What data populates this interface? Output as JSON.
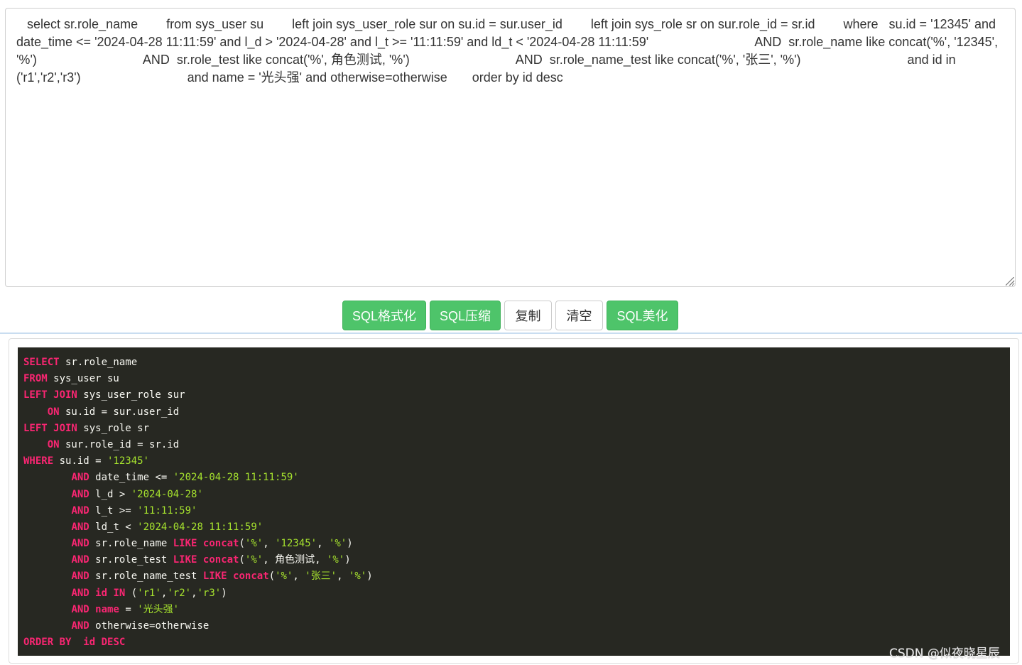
{
  "editor": {
    "raw_sql": "   select sr.role_name        from sys_user su        left join sys_user_role sur on su.id = sur.user_id        left join sys_role sr on sur.role_id = sr.id        where   su.id = '12345' and date_time <= '2024-04-28 11:11:59' and l_d > '2024-04-28' and l_t >= '11:11:59' and ld_t < '2024-04-28 11:11:59'                              AND  sr.role_name like concat('%', '12345', '%')                              AND  sr.role_test like concat('%', 角色测试, '%')                              AND  sr.role_name_test like concat('%', '张三', '%')                              and id in                          ('r1','r2','r3')                              and name = '光头强' and otherwise=otherwise       order by id desc"
  },
  "toolbar": {
    "format_label": "SQL格式化",
    "compress_label": "SQL压缩",
    "copy_label": "复制",
    "clear_label": "清空",
    "beautify_label": "SQL美化"
  },
  "output": {
    "lines": [
      [
        {
          "t": "SELECT",
          "c": "kw"
        },
        {
          "t": " sr.role_name"
        }
      ],
      [
        {
          "t": "FROM",
          "c": "kw"
        },
        {
          "t": " sys_user su"
        }
      ],
      [
        {
          "t": "LEFT JOIN",
          "c": "kw"
        },
        {
          "t": " sys_user_role sur"
        }
      ],
      [
        {
          "t": "    "
        },
        {
          "t": "ON",
          "c": "kw"
        },
        {
          "t": " su.id = sur.user_id"
        }
      ],
      [
        {
          "t": "LEFT JOIN",
          "c": "kw"
        },
        {
          "t": " sys_role sr"
        }
      ],
      [
        {
          "t": "    "
        },
        {
          "t": "ON",
          "c": "kw"
        },
        {
          "t": " sur.role_id = sr.id"
        }
      ],
      [
        {
          "t": "WHERE",
          "c": "kw"
        },
        {
          "t": " su.id = "
        },
        {
          "t": "'12345'",
          "c": "str"
        }
      ],
      [
        {
          "t": "        "
        },
        {
          "t": "AND",
          "c": "kw"
        },
        {
          "t": " date_time <= "
        },
        {
          "t": "'2024-04-28 11:11:59'",
          "c": "str"
        }
      ],
      [
        {
          "t": "        "
        },
        {
          "t": "AND",
          "c": "kw"
        },
        {
          "t": " l_d > "
        },
        {
          "t": "'2024-04-28'",
          "c": "str"
        }
      ],
      [
        {
          "t": "        "
        },
        {
          "t": "AND",
          "c": "kw"
        },
        {
          "t": " l_t >= "
        },
        {
          "t": "'11:11:59'",
          "c": "str"
        }
      ],
      [
        {
          "t": "        "
        },
        {
          "t": "AND",
          "c": "kw"
        },
        {
          "t": " ld_t < "
        },
        {
          "t": "'2024-04-28 11:11:59'",
          "c": "str"
        }
      ],
      [
        {
          "t": "        "
        },
        {
          "t": "AND",
          "c": "kw"
        },
        {
          "t": " sr.role_name "
        },
        {
          "t": "LIKE",
          "c": "kw"
        },
        {
          "t": " "
        },
        {
          "t": "concat",
          "c": "kw"
        },
        {
          "t": "("
        },
        {
          "t": "'%'",
          "c": "str"
        },
        {
          "t": ", "
        },
        {
          "t": "'12345'",
          "c": "str"
        },
        {
          "t": ", "
        },
        {
          "t": "'%'",
          "c": "str"
        },
        {
          "t": ")"
        }
      ],
      [
        {
          "t": "        "
        },
        {
          "t": "AND",
          "c": "kw"
        },
        {
          "t": " sr.role_test "
        },
        {
          "t": "LIKE",
          "c": "kw"
        },
        {
          "t": " "
        },
        {
          "t": "concat",
          "c": "kw"
        },
        {
          "t": "("
        },
        {
          "t": "'%'",
          "c": "str"
        },
        {
          "t": ", 角色测试, "
        },
        {
          "t": "'%'",
          "c": "str"
        },
        {
          "t": ")"
        }
      ],
      [
        {
          "t": "        "
        },
        {
          "t": "AND",
          "c": "kw"
        },
        {
          "t": " sr.role_name_test "
        },
        {
          "t": "LIKE",
          "c": "kw"
        },
        {
          "t": " "
        },
        {
          "t": "concat",
          "c": "kw"
        },
        {
          "t": "("
        },
        {
          "t": "'%'",
          "c": "str"
        },
        {
          "t": ", "
        },
        {
          "t": "'张三'",
          "c": "str"
        },
        {
          "t": ", "
        },
        {
          "t": "'%'",
          "c": "str"
        },
        {
          "t": ")"
        }
      ],
      [
        {
          "t": "        "
        },
        {
          "t": "AND",
          "c": "kw"
        },
        {
          "t": " "
        },
        {
          "t": "id",
          "c": "kw"
        },
        {
          "t": " "
        },
        {
          "t": "IN",
          "c": "kw"
        },
        {
          "t": " ("
        },
        {
          "t": "'r1'",
          "c": "str"
        },
        {
          "t": ","
        },
        {
          "t": "'r2'",
          "c": "str"
        },
        {
          "t": ","
        },
        {
          "t": "'r3'",
          "c": "str"
        },
        {
          "t": ")"
        }
      ],
      [
        {
          "t": "        "
        },
        {
          "t": "AND",
          "c": "kw"
        },
        {
          "t": " "
        },
        {
          "t": "name",
          "c": "kw"
        },
        {
          "t": " = "
        },
        {
          "t": "'光头强'",
          "c": "str"
        }
      ],
      [
        {
          "t": "        "
        },
        {
          "t": "AND",
          "c": "kw"
        },
        {
          "t": " otherwise=otherwise"
        }
      ],
      [
        {
          "t": "ORDER BY",
          "c": "kw"
        },
        {
          "t": "  "
        },
        {
          "t": "id DESC",
          "c": "kw"
        }
      ]
    ]
  },
  "watermark": "CSDN @似夜晓星辰",
  "colors": {
    "keyword": "#f92672",
    "string": "#a6e22e",
    "code_bg": "#272822",
    "button_green": "#4ec46a"
  }
}
